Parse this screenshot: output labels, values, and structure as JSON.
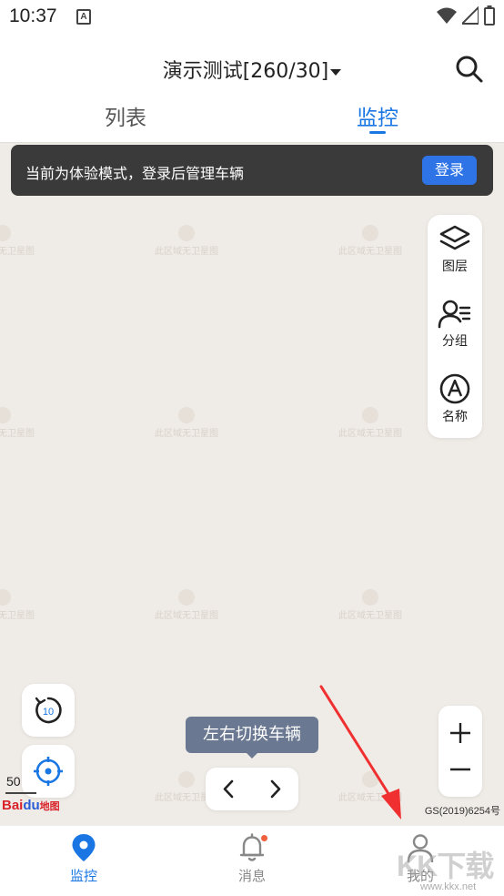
{
  "status_bar": {
    "time": "10:37",
    "notice_icon_label": "A"
  },
  "header": {
    "title": "演示测试[260/30]",
    "tabs": [
      {
        "label": "列表",
        "active": false
      },
      {
        "label": "监控",
        "active": true
      }
    ]
  },
  "banner": {
    "text": "当前为体验模式，登录后管理车辆",
    "login_label": "登录"
  },
  "side_panel": {
    "items": [
      {
        "label": "图层",
        "icon": "layers-icon"
      },
      {
        "label": "分组",
        "icon": "group-icon"
      },
      {
        "label": "名称",
        "icon": "name-icon"
      }
    ]
  },
  "map": {
    "watermark_text": "此区域无卫星图",
    "refresh_badge": "10",
    "tooltip": "左右切换车辆",
    "scale": "50",
    "logo_main": "Bai",
    "logo_paw": "du",
    "logo_sub": "地图",
    "copyright": "GS(2019)6254号"
  },
  "bottom_nav": {
    "items": [
      {
        "label": "监控",
        "active": true
      },
      {
        "label": "消息",
        "active": false
      },
      {
        "label": "我的",
        "active": false
      }
    ]
  },
  "overlay": {
    "site_mark": "KK下载",
    "site_url": "www.kkx.net"
  },
  "colors": {
    "accent": "#1976e3",
    "banner_bg": "#3a3a3a",
    "login_btn": "#2f74e6",
    "tooltip_bg": "#6a7892",
    "arrow": "#f03030"
  }
}
